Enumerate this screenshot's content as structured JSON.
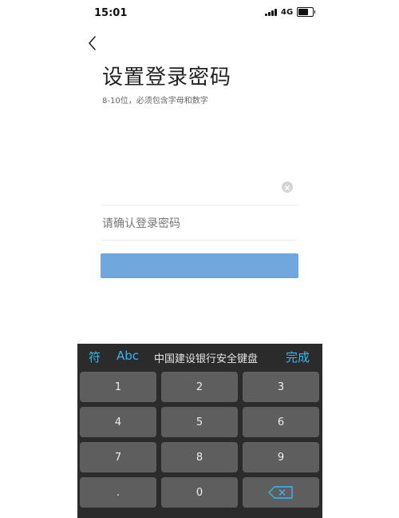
{
  "status_bar": {
    "time": "15:01",
    "network": "4G"
  },
  "header": {
    "title": "设置登录密码",
    "hint": "8-10位，必须包含字母和数字"
  },
  "form": {
    "confirm_placeholder": "请确认登录密码",
    "accent_color": "#6fa8dc"
  },
  "keyboard": {
    "symbols_label": "符",
    "abc_label": "Abc",
    "title": "中国建设银行安全键盘",
    "done_label": "完成",
    "keys": [
      "1",
      "2",
      "3",
      "4",
      "5",
      "6",
      "7",
      "8",
      "9",
      ".",
      "0"
    ],
    "delete_icon": "backspace-icon"
  }
}
